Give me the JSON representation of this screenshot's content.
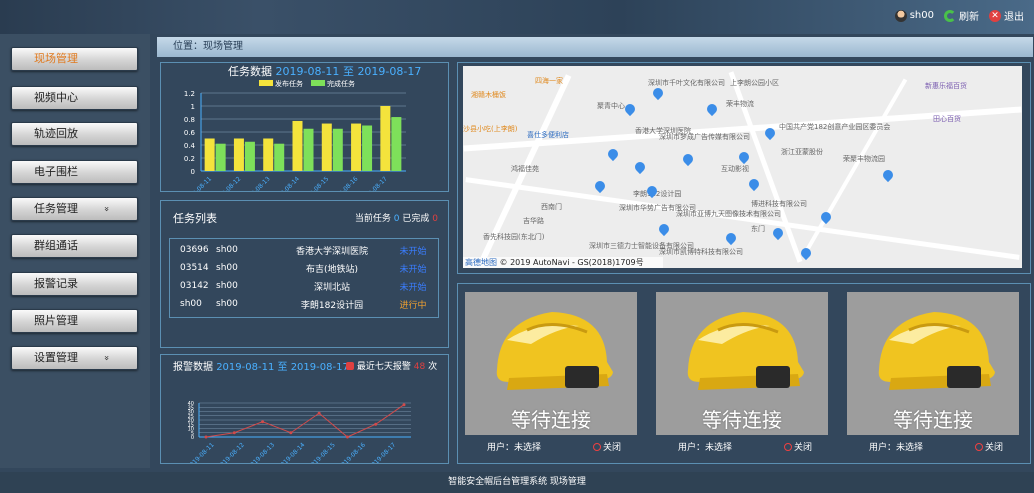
{
  "header": {
    "username": "sh00",
    "refresh": "刷新",
    "logout": "退出"
  },
  "nav": [
    {
      "label": "现场管理",
      "active": true
    },
    {
      "label": "视频中心"
    },
    {
      "label": "轨迹回放"
    },
    {
      "label": "电子围栏"
    },
    {
      "label": "任务管理",
      "chevron": true
    },
    {
      "label": "群组通话"
    },
    {
      "label": "报警记录"
    },
    {
      "label": "照片管理"
    },
    {
      "label": "设置管理",
      "chevron": true
    }
  ],
  "breadcrumb": "位置：现场管理",
  "task_chart": {
    "title": "任务数据",
    "range_start": "2019-08-11",
    "range_sep": "至",
    "range_end": "2019-08-17",
    "legend": [
      "发布任务",
      "完成任务"
    ]
  },
  "task_list": {
    "title": "任务列表",
    "current_label": "当前任务",
    "current_count": "0",
    "done_label": "已完成",
    "done_count": "0",
    "rows": [
      [
        "03696",
        "sh00",
        "香港大学深圳医院",
        "未开始"
      ],
      [
        "03514",
        "sh00",
        "布吉(地铁站)",
        "未开始"
      ],
      [
        "03142",
        "sh00",
        "深圳北站",
        "未开始"
      ],
      [
        "sh00",
        "sh00",
        "李朗182设计园",
        "进行中"
      ]
    ]
  },
  "alarm_chart": {
    "title": "报警数据",
    "range_start": "2019-08-11",
    "range_sep": "至",
    "range_end": "2019-08-17",
    "recent_label": "最近七天报警",
    "recent_count": "48",
    "recent_unit": "次"
  },
  "map": {
    "copyright": "© 2019 AutoNavi - GS(2018)1709号",
    "logo": "高德地图",
    "labels": [
      "上李朗公园小区",
      "新惠乐福百货",
      "田心百货",
      "深圳市千叶文化有限公司",
      "聚青中心",
      "荣丰物流",
      "中国共产党182创意产业园区委员会",
      "浙江亚蒙股份",
      "互动影视",
      "香港大学深圳医院",
      "沙县小吃(上李朗)",
      "喜仕多便利店",
      "鸿福佳苑",
      "西南门",
      "李朗182设计园",
      "深圳市华势广告有限公司",
      "深圳市亚博九天图像技术有限公司",
      "博进科技有限公司",
      "东门",
      "荣聚丰物流园",
      "深圳市三德力士智能设备有限公司",
      "深圳市凯博特科技有限公司",
      "香先科技园(东北门)",
      "四海一家",
      "湘赣木桶饭",
      "深圳市梦成广告传媒有限公司",
      "吉华路"
    ]
  },
  "cameras": [
    {
      "status": "等待连接",
      "user": "用户：未选择",
      "close": "关闭"
    },
    {
      "status": "等待连接",
      "user": "用户：未选择",
      "close": "关闭"
    },
    {
      "status": "等待连接",
      "user": "用户：未选择",
      "close": "关闭"
    }
  ],
  "footer": "智能安全帽后台管理系统  现场管理",
  "colors": {
    "published": "#f4e33c",
    "completed": "#7ee05a",
    "alarm_line": "#d24a4a",
    "accent": "#4ab0ff",
    "panel_border": "#5b8fb2"
  },
  "chart_data": [
    {
      "type": "bar",
      "title": "",
      "categories": [
        "2019-08-11",
        "2019-08-12",
        "2019-08-13",
        "2019-08-14",
        "2019-08-15",
        "2019-08-16",
        "2019-08-17"
      ],
      "series": [
        {
          "name": "发布任务",
          "values": [
            0.5,
            0.5,
            0.5,
            0.77,
            0.73,
            0.73,
            1.0
          ]
        },
        {
          "name": "完成任务",
          "values": [
            0.42,
            0.45,
            0.42,
            0.65,
            0.65,
            0.7,
            0.83
          ]
        }
      ],
      "yticks": [
        "0",
        "0.2",
        "0.4",
        "0.6",
        "0.8",
        "1",
        "1.2"
      ],
      "ylim": [
        0,
        1.2
      ]
    },
    {
      "type": "line",
      "categories": [
        "2019-08-11",
        "2019-08-12",
        "2019-08-13",
        "2019-08-14",
        "2019-08-15",
        "2019-08-16",
        "2019-08-17"
      ],
      "series": [
        {
          "values": [
            0,
            5,
            18,
            5,
            28,
            0,
            15,
            38
          ]
        }
      ],
      "x": [
        "2019-08-11",
        "2019-08-12",
        "2019-08-12",
        "2019-08-13",
        "2019-08-14",
        "2019-08-15",
        "2019-08-16",
        "2019-08-17"
      ],
      "yticks": [
        "0",
        "5",
        "10",
        "15",
        "20",
        "25",
        "30",
        "35",
        "40"
      ],
      "ylim": [
        0,
        40
      ]
    }
  ]
}
